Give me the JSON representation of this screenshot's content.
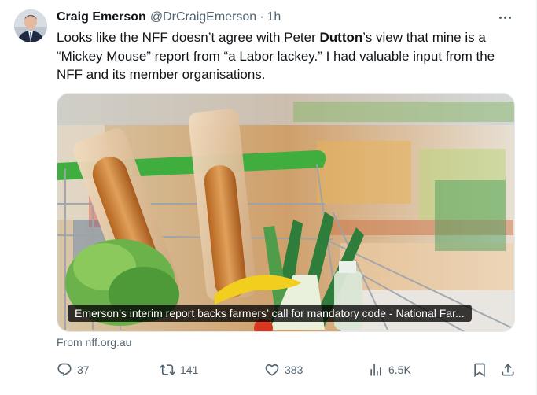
{
  "author": {
    "name": "Craig Emerson",
    "handle": "@DrCraigEmerson",
    "separator": "·",
    "time": "1h"
  },
  "tweet": {
    "text_before": "Looks like the NFF doesn’t agree with Peter ",
    "text_bold": "Dutton",
    "text_after": "’s view that mine is a “Mickey Mouse” report from “a Labor lackey.” I had valuable input from the NFF and its member organisations."
  },
  "card": {
    "caption": "Emerson’s interim report backs farmers’ call for mandatory code  - National Far...",
    "source": "From nff.org.au"
  },
  "actions": {
    "replies": "37",
    "reposts": "141",
    "likes": "383",
    "views": "6.5K"
  },
  "icons": {
    "more": "more-horizontal-icon",
    "reply": "reply-icon",
    "repost": "repost-icon",
    "like": "heart-icon",
    "views": "views-chart-icon",
    "bookmark": "bookmark-icon",
    "share": "share-icon"
  },
  "colors": {
    "text": "#0f1419",
    "secondary": "#536471",
    "border": "#eff3f4"
  }
}
